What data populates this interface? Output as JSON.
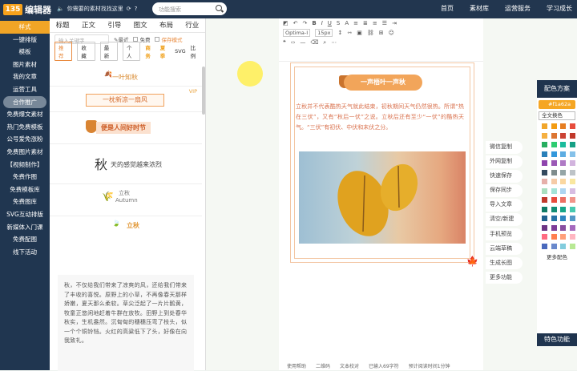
{
  "app": {
    "logo_mark": "135",
    "logo_text": "编辑器",
    "notice": "你需要的素材找找这里",
    "search_placeholder": "功能搜索"
  },
  "topnav": [
    "首页",
    "素材库",
    "运营服务",
    "学习成长"
  ],
  "leftnav": [
    "样式",
    "一键排版",
    "模板",
    "图片素材",
    "我的文章",
    "运营工具",
    "合作推广",
    "免费爆文素材",
    "热门免费模板",
    "公号爱免涨粉",
    "免费图片素材",
    "【视频制作】",
    "免费作图",
    "免费模板库",
    "免费图库",
    "SVG互动排版",
    "新媒体入门课",
    "免费配图",
    "线下活动"
  ],
  "panel": {
    "tabs": [
      "标题",
      "正文",
      "引导",
      "图文",
      "布局",
      "行业"
    ],
    "keyword_placeholder": "输入关键字",
    "options": [
      "最近",
      "免费",
      "保存模式"
    ],
    "chips": [
      "推荐",
      "收藏",
      "最新",
      "个人"
    ],
    "orange_chips": [
      "商务",
      "夏季"
    ],
    "chip_svg": "SVG",
    "chip_more": "比例",
    "cards": [
      "一叶知秋",
      "一枕新凉一扇风",
      "VIP",
      "便是人间好时节",
      "秋",
      "天的感觉越来浓烈",
      "立秋",
      "Autumn",
      "立秋"
    ],
    "poem": "秋，不仅给我们带来了凉爽的风，还给我们带来了丰收的喜悦。原野上的小草，不再像春天那样娇嫩，夏天那么柔软。草尖泛起了一片片鹅黄，牧童正悠闲地赶着牛群在放牧。田野上到处春华秋实，生机盎然。沉甸甸的穗穗压弯了枝头，似一个个铜铃铛。火红的高粱低下了头，好像在向我致礼。"
  },
  "toolbar": {
    "font": "Optima-I",
    "size": "15px"
  },
  "article": {
    "title": "一声梧叶一声秋",
    "body": "立秋并不代表酷热天气就此结束，初秋期间天气仍然很热。所谓“热在三伏”，又有“秋后一伏”之说。立秋后还有至少“一伏”的酷热天气。“三伏”有初伏、中伏和末伏之分。"
  },
  "actions": [
    "微信复制",
    "外网复制",
    "快速保存",
    "保存同步",
    "导入文章",
    "清空/新建",
    "手机预览",
    "云端草稿",
    "生成长图",
    "更多功能"
  ],
  "bottombar": [
    "使用帮助",
    "二维码",
    "文本校对",
    "已输入69字符",
    "预计阅读时间1分钟"
  ],
  "colors": {
    "title": "配色方案",
    "hex": "#f1a62a",
    "swap": "全文换色",
    "more": "更多配色",
    "footer": "特色功能",
    "swatches": [
      "#f1a62a",
      "#f39c12",
      "#e67e22",
      "#e74c3c",
      "#f5b041",
      "#dc7633",
      "#cb4335",
      "#c0392b",
      "#27ae60",
      "#2ecc71",
      "#1abc9c",
      "#16a085",
      "#2980b9",
      "#3498db",
      "#5dade2",
      "#85c1e9",
      "#8e44ad",
      "#9b59b6",
      "#af7ac5",
      "#d2b4de",
      "#34495e",
      "#7f8c8d",
      "#95a5a6",
      "#bdc3c7",
      "#e6b0aa",
      "#f5cba7",
      "#fad7a0",
      "#f9e79f",
      "#a9dfbf",
      "#a3e4d7",
      "#aed6f1",
      "#d7bde2",
      "#c0392b",
      "#e74c3c",
      "#ec7063",
      "#f1948a",
      "#117a65",
      "#138d75",
      "#17a589",
      "#48c9b0",
      "#1f618d",
      "#2874a6",
      "#2e86c1",
      "#5499c7",
      "#6c3483",
      "#7d3c98",
      "#884ea0",
      "#a569bd",
      "#ff6b81",
      "#ff7f50",
      "#ffa07a",
      "#ffb6c1",
      "#4a69bd",
      "#6a89cc",
      "#82ccdd",
      "#b8e994"
    ]
  }
}
